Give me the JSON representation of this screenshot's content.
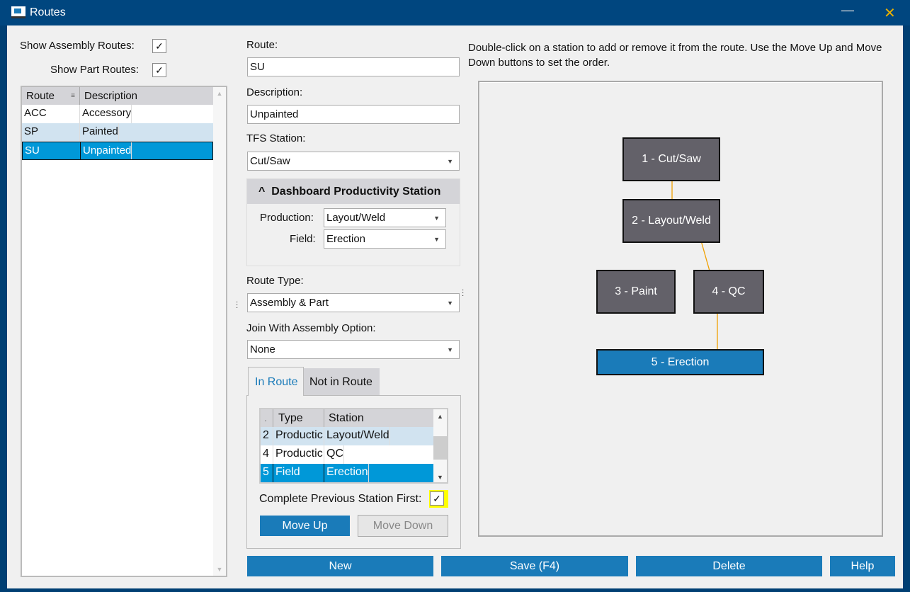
{
  "window": {
    "title": "Routes"
  },
  "filters": {
    "show_assembly_label": "Show Assembly Routes:",
    "show_assembly_checked": true,
    "show_part_label": "Show Part Routes:",
    "show_part_checked": true
  },
  "routes_table": {
    "headers": [
      "Route",
      "Description"
    ],
    "rows": [
      {
        "route": "ACC",
        "description": "Accessory"
      },
      {
        "route": "SP",
        "description": "Painted"
      },
      {
        "route": "SU",
        "description": "Unpainted"
      }
    ],
    "selected": "SU"
  },
  "form": {
    "route_label": "Route:",
    "route_value": "SU",
    "description_label": "Description:",
    "description_value": "Unpainted",
    "tfs_label": "TFS Station:",
    "tfs_value": "Cut/Saw",
    "dashboard_title": "Dashboard Productivity Station",
    "production_label": "Production:",
    "production_value": "Layout/Weld",
    "field_label": "Field:",
    "field_value": "Erection",
    "route_type_label": "Route Type:",
    "route_type_value": "Assembly & Part",
    "join_label": "Join With Assembly Option:",
    "join_value": "None"
  },
  "tabs": [
    {
      "label": "In Route",
      "active": true
    },
    {
      "label": "Not in Route",
      "active": false
    }
  ],
  "in_route_table": {
    "headers": [
      ".",
      "Type",
      "Station"
    ],
    "rows": [
      {
        "n": "2",
        "type": "Productic",
        "station": "Layout/Weld"
      },
      {
        "n": "4",
        "type": "Productic",
        "station": "QC"
      },
      {
        "n": "5",
        "type": "Field",
        "station": "Erection"
      }
    ]
  },
  "complete_prev_label": "Complete Previous Station First:",
  "complete_prev_checked": true,
  "move_up": "Move Up",
  "move_down": "Move Down",
  "instructions": "Double-click on a station to add or remove it from the route.  Use the Move Up and Move Down buttons to set the order.",
  "diagram": {
    "stations": [
      "1 - Cut/Saw",
      "2 - Layout/Weld",
      "3 - Paint",
      "4 - QC",
      "5 - Erection"
    ],
    "arrow_color": "#f0a000"
  },
  "footer": {
    "new": "New",
    "save": "Save (F4)",
    "delete": "Delete",
    "help": "Help"
  },
  "colors": {
    "title_bg": "#00467f",
    "accent": "#1a7bb9",
    "selected": "#0098d8"
  }
}
